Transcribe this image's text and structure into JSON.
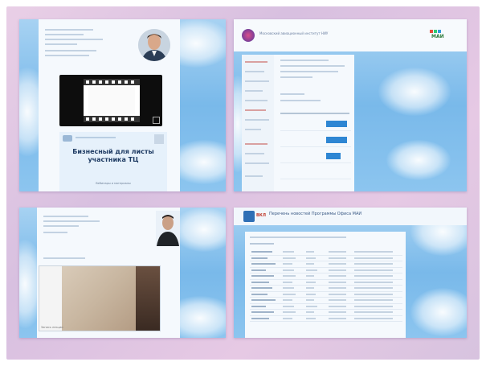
{
  "panels": {
    "top_left": {
      "promo_title": "Бизнесный для листы\nучастника ТЦ",
      "promo_caption": "Вебинары и материалы"
    },
    "top_right": {
      "site_title": "Московский авиационный институт НИУ",
      "logo_text": "МАИ",
      "sidebar_items": [
        "Расписание",
        "Кафедры",
        "Студенты",
        "Курсы",
        "Новости",
        "Контакты",
        "Архив",
        "Справка"
      ]
    },
    "bottom_left": {
      "video_caption": "Запись лекции"
    },
    "bottom_right": {
      "header_logo": "ВКЛ",
      "header_title": "Перечень новостей Программы Офиса МАИ",
      "table_rows": 12
    }
  },
  "colors": {
    "frame": "#e3cbe3",
    "sky": "#86c2ee",
    "accent_blue": "#2e86d3",
    "red_link": "#c0392b"
  }
}
